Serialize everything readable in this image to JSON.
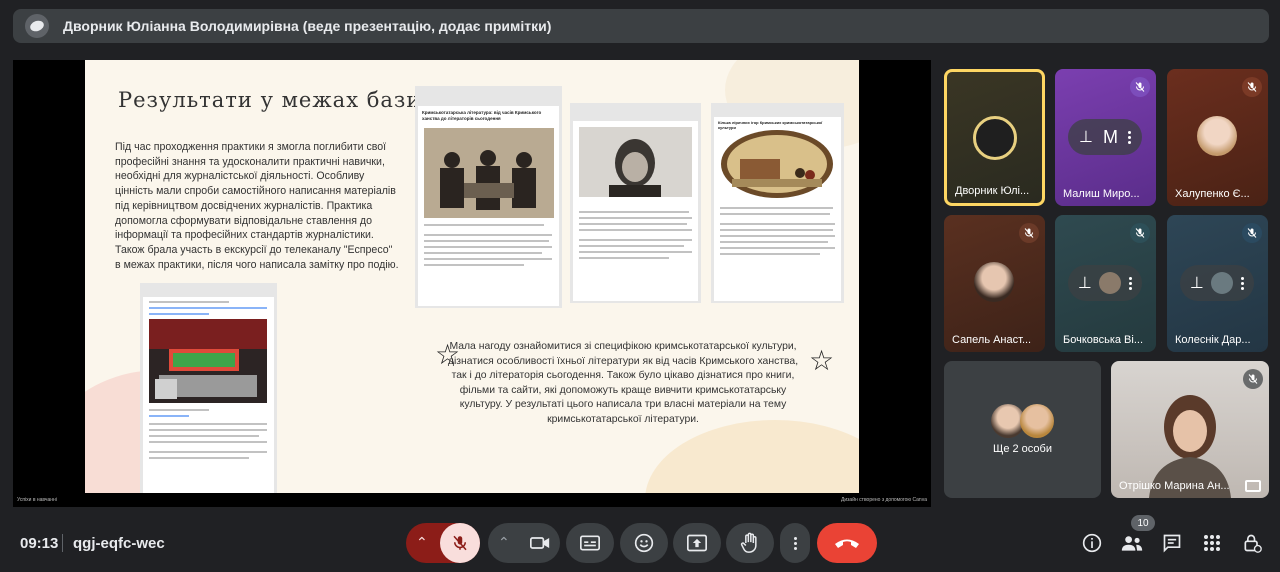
{
  "banner": {
    "title": "Дворник Юліанна Володимирівна (веде презентацію, додає примітки)"
  },
  "slide": {
    "title": "Результати у межах бази практики",
    "body": "Під час проходження практики я змогла поглибити свої професійні знання та удосконалити практичні навички, необхідні для журналістської діяльності. Особливу цінність мали спроби самостійного написання матеріалів під керівництвом досвідчених журналістів. Практика допомогла сформувати відповідальне ставлення до інформації та професійних стандартів журналістики. Також брала участь в екскурсії до телеканалу \"Еспресо\" в межах практики, після чого написала замітку про подію.",
    "caption": "Мала нагоду ознайомитися зі специфікою кримськотатарської культури, дізнатися особливості їхньої літератури як від часів Кримського ханства, так і до літераторія сьогодення. Також було цікаво дізнатися про книги, фільми та сайти, які допоможуть краще вивчити кримськотатарську культуру. У результаті цього написала три власні матеріали на тему кримськотатарської літератури.",
    "doc1_heading": "Кримськотатарська література: від часів Кримського ханства до літераторів сьогодення",
    "doc3_heading": "Кілька ліричних ігор Кримських кримськотатарської культури",
    "footer_left": "Успіхи в навчанні",
    "footer_right": "Дизайн створено з допомогою Canva"
  },
  "participants": [
    {
      "name": "Дворник Юлі...",
      "muted": false,
      "highlight": true
    },
    {
      "name": "Малиш Миро...",
      "muted": true,
      "pill_letter": "М"
    },
    {
      "name": "Халупенко Є...",
      "muted": true
    },
    {
      "name": "Сапель Анаст...",
      "muted": true
    },
    {
      "name": "Бочковська Ві...",
      "muted": true
    },
    {
      "name": "Колеснік Дар...",
      "muted": true
    },
    {
      "name": "Ще 2 особи",
      "muted": false
    },
    {
      "name": "Отрішко Марина Ан...",
      "muted": true
    }
  ],
  "meeting": {
    "time": "09:13",
    "code": "qgj-eqfc-wec",
    "people_count": "10"
  },
  "icons": {
    "mic_off": "mic-off-icon",
    "camera": "camera-icon",
    "captions": "captions-icon",
    "emoji": "emoji-icon",
    "present": "present-icon",
    "hand": "raise-hand-icon",
    "more": "more-options-icon",
    "end_call": "end-call-icon",
    "info": "info-icon",
    "people": "people-icon",
    "chat": "chat-icon",
    "activities": "activities-icon",
    "host_controls": "host-controls-icon"
  },
  "colors": {
    "end_call": "#ea4335",
    "mic_off": "#f9dedc",
    "mic_off_dark": "#8c1d18",
    "tile_highlight": "#fdd663"
  }
}
